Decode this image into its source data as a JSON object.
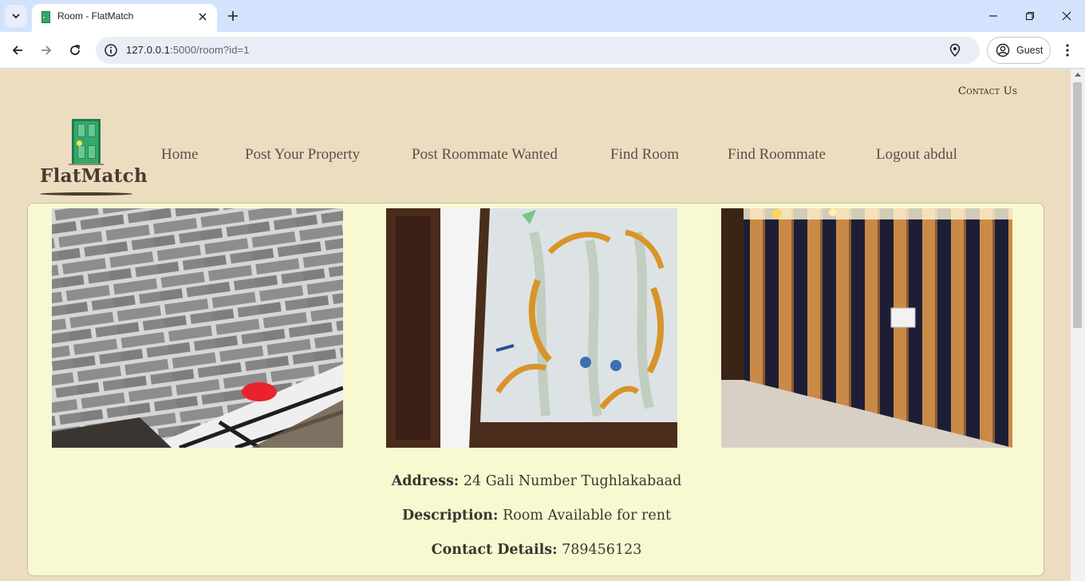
{
  "browser": {
    "tab_title": "Room - FlatMatch",
    "url_host": "127.0.0.1",
    "url_rest": ":5000/room?id=1",
    "profile_label": "Guest"
  },
  "page": {
    "contact_link": "Contact Us",
    "logo_text": "FlatMatch",
    "nav": [
      {
        "label": "Home"
      },
      {
        "label": "Post Your Property"
      },
      {
        "label": "Post Roommate Wanted"
      },
      {
        "label": "Find Room"
      },
      {
        "label": "Find Roommate"
      },
      {
        "label": "Logout abdul"
      }
    ],
    "details": {
      "address_label": "Address:",
      "address_value": "24 Gali Number Tughlakabaad",
      "description_label": "Description:",
      "description_value": "Room Available for rent",
      "contact_label": "Contact Details:",
      "contact_value": "789456123"
    }
  },
  "colors": {
    "page_bg": "#ecdcc0",
    "card_bg": "#f8f8d1",
    "logo_green": "#34a86b",
    "text_brown": "#4a3b30"
  }
}
